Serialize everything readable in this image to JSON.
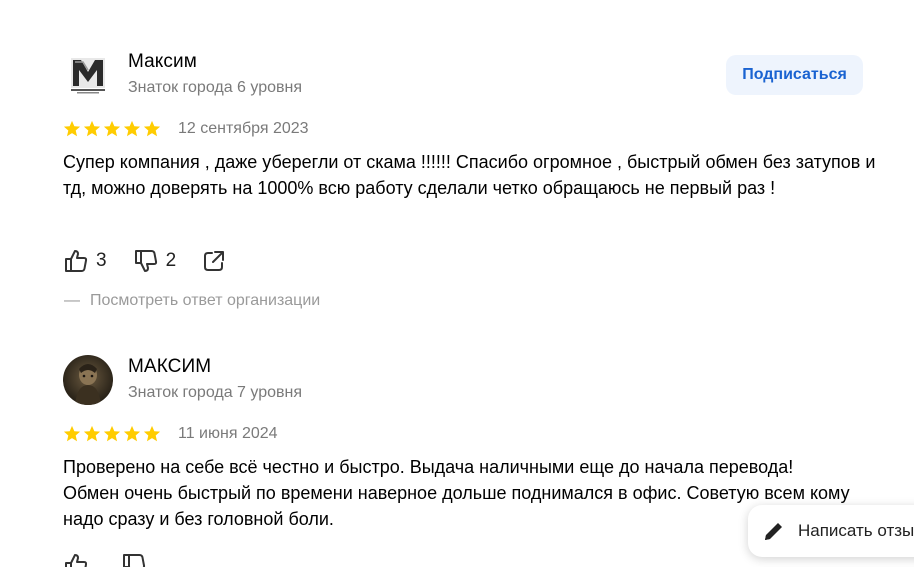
{
  "reviews": [
    {
      "author": "Максим",
      "level": "Знаток города 6 уровня",
      "rating": 5,
      "date": "12 сентября 2023",
      "text": "Супер компания , даже уберегли от скама !!!!!! Спасибо огромное , быстрый обмен без затупов и тд, можно доверять на 1000% всю работу сделали четко обращаюсь не первый раз !",
      "likes": "3",
      "dislikes": "2",
      "org_reply_link": "Посмотреть ответ организации",
      "subscribe_label": "Подписаться"
    },
    {
      "author": "МАКСИМ",
      "level": "Знаток города 7 уровня",
      "rating": 5,
      "date": "11 июня 2024",
      "text": "Проверено на себе всё честно и быстро. Выдача наличными еще до начала перевода! Обмен очень быстрый по времени наверное дольше поднимался в офис. Советую всем кому надо сразу и без головной боли."
    }
  ],
  "write_review": {
    "label": "Написать отзыв"
  },
  "colors": {
    "star": "#fc0",
    "accent": "#1a63d1",
    "subscribe_bg": "#eef4fd",
    "muted": "#7a7a7a"
  },
  "icons": [
    "like-icon",
    "dislike-icon",
    "share-icon",
    "star-icon",
    "pencil-icon"
  ]
}
